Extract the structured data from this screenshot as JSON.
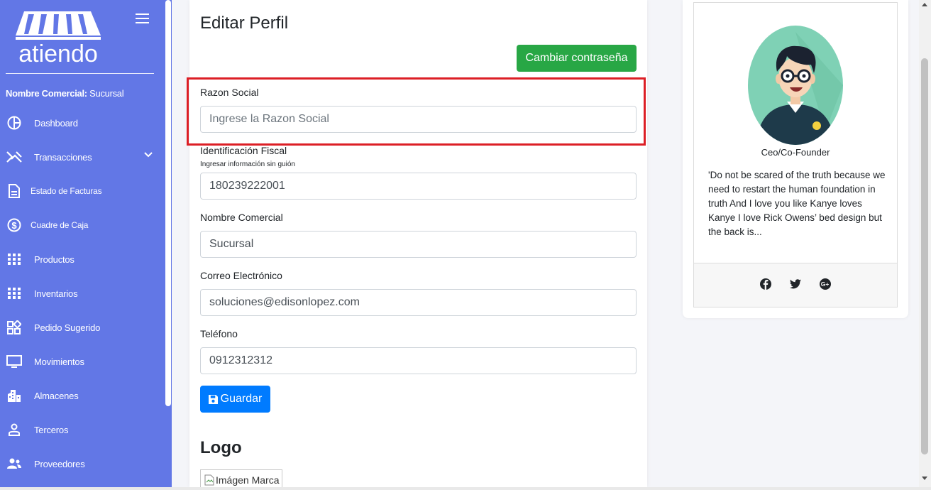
{
  "sidebar": {
    "logo_text": "atiendo",
    "commercial_label": "Nombre Comercial:",
    "commercial_value": "Sucursal",
    "items": [
      {
        "label": "Dashboard",
        "icon": "pie-chart-icon"
      },
      {
        "label": "Transacciones",
        "icon": "transactions-icon"
      },
      {
        "label": "Estado de Facturas",
        "icon": "document-icon"
      },
      {
        "label": "Cuadre de Caja",
        "icon": "dollar-circle-icon"
      },
      {
        "label": "Productos",
        "icon": "grid-icon"
      },
      {
        "label": "Inventarios",
        "icon": "grid-icon"
      },
      {
        "label": "Pedido Sugerido",
        "icon": "widgets-icon"
      },
      {
        "label": "Movimientos",
        "icon": "monitor-icon"
      },
      {
        "label": "Almacenes",
        "icon": "building-icon"
      },
      {
        "label": "Terceros",
        "icon": "person-icon"
      },
      {
        "label": "Proveedores",
        "icon": "people-icon"
      }
    ]
  },
  "form": {
    "title": "Editar Perfil",
    "change_password_label": "Cambiar contraseña",
    "razon_social_label": "Razon Social",
    "razon_social_placeholder": "Ingrese la Razon Social",
    "razon_social_value": "",
    "id_fiscal_label": "Identificación Fiscal",
    "id_fiscal_hint": "Ingresar información sin guión",
    "id_fiscal_value": "180239222001",
    "nombre_comercial_label": "Nombre Comercial",
    "nombre_comercial_value": "Sucursal",
    "correo_label": "Correo Electrónico",
    "correo_value": "soluciones@edisonlopez.com",
    "telefono_label": "Teléfono",
    "telefono_value": "0912312312",
    "save_label": "Guardar",
    "logo_title": "Logo",
    "brand_image_alt": "Imágen Marca"
  },
  "profile": {
    "role": "Ceo/Co-Founder",
    "quote": "'Do not be scared of the truth because we need to restart the human foundation in truth And I love you like Kanye loves Kanye I love Rick Owens’ bed design but the back is...",
    "social": [
      "facebook-icon",
      "twitter-icon",
      "google-plus-icon"
    ]
  },
  "colors": {
    "sidebar": "#6277e6",
    "success": "#28a745",
    "primary": "#007bff",
    "highlight": "#dc1f26"
  }
}
